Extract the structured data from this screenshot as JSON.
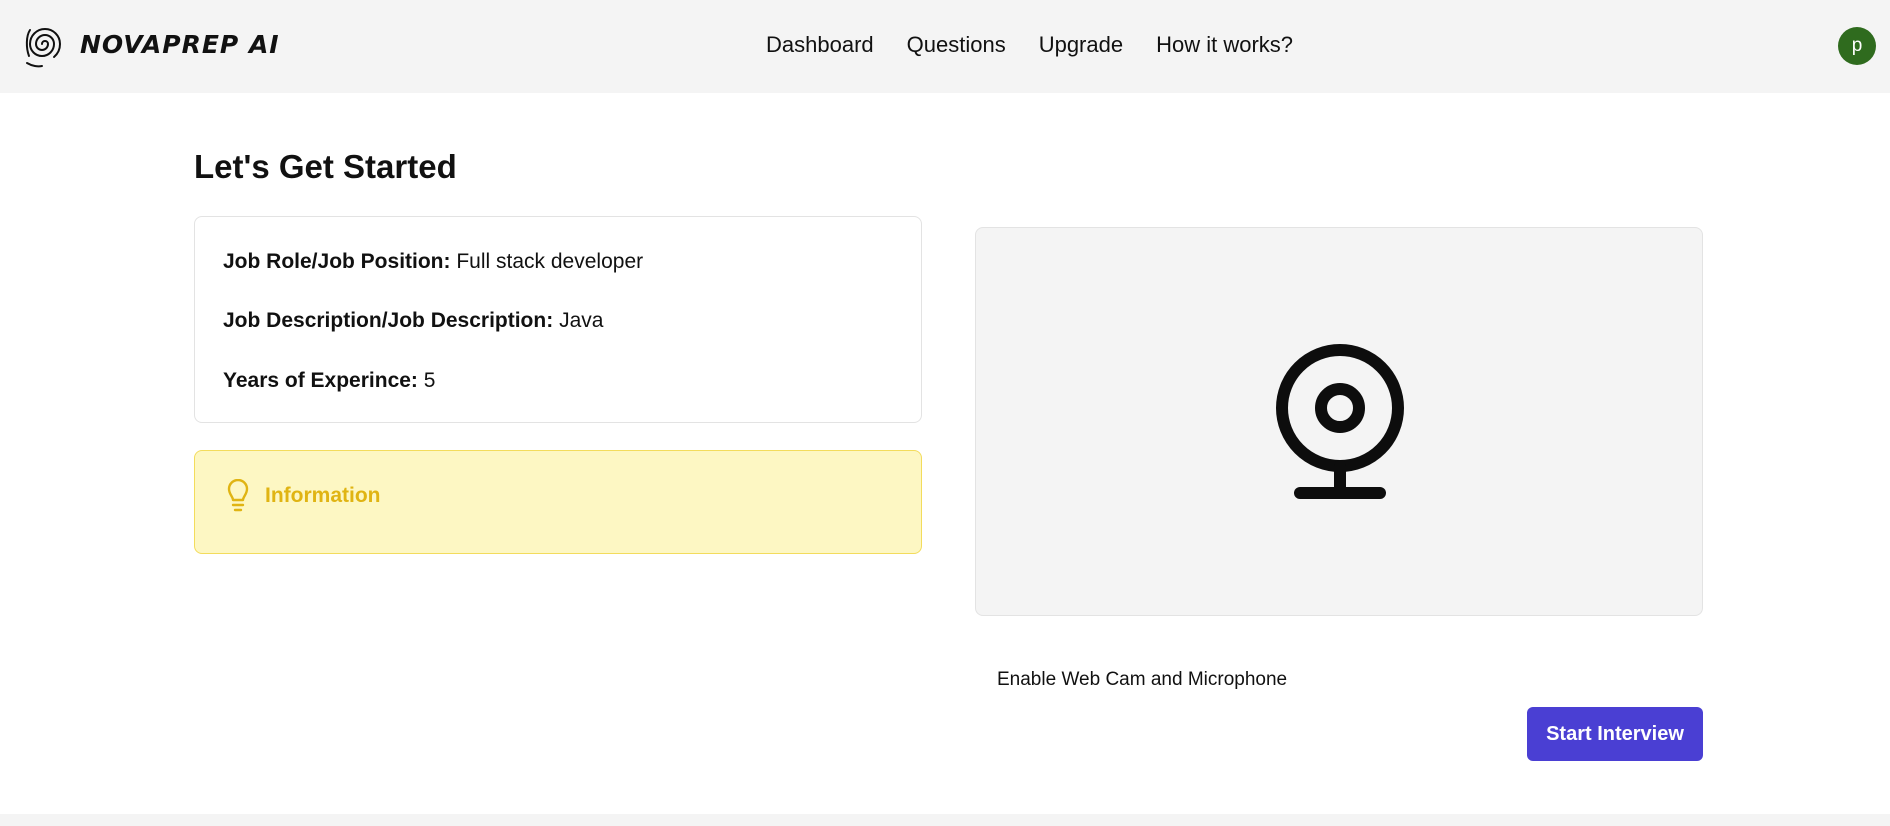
{
  "brand": {
    "name": "NOVAPREP AI",
    "logo_icon": "spiral-fingerprint-icon"
  },
  "nav": {
    "items": [
      {
        "label": "Dashboard"
      },
      {
        "label": "Questions"
      },
      {
        "label": "Upgrade"
      },
      {
        "label": "How it works?"
      }
    ]
  },
  "user": {
    "avatar_initial": "p",
    "avatar_color": "#2f6b1e"
  },
  "page": {
    "title": "Let's Get Started"
  },
  "details": {
    "job_role_label": "Job Role/Job Position:",
    "job_role_value": "Full stack developer",
    "job_desc_label": "Job Description/Job Description:",
    "job_desc_value": "Java",
    "years_label": "Years of Experince:",
    "years_value": "5"
  },
  "info": {
    "title": "Information",
    "icon": "lightbulb-icon",
    "accent": "#e0b413",
    "background": "#fdf7c3"
  },
  "webcam": {
    "icon": "webcam-icon",
    "enable_label": "Enable Web Cam and Microphone"
  },
  "actions": {
    "start_label": "Start Interview",
    "start_color": "#4a3fd3"
  }
}
